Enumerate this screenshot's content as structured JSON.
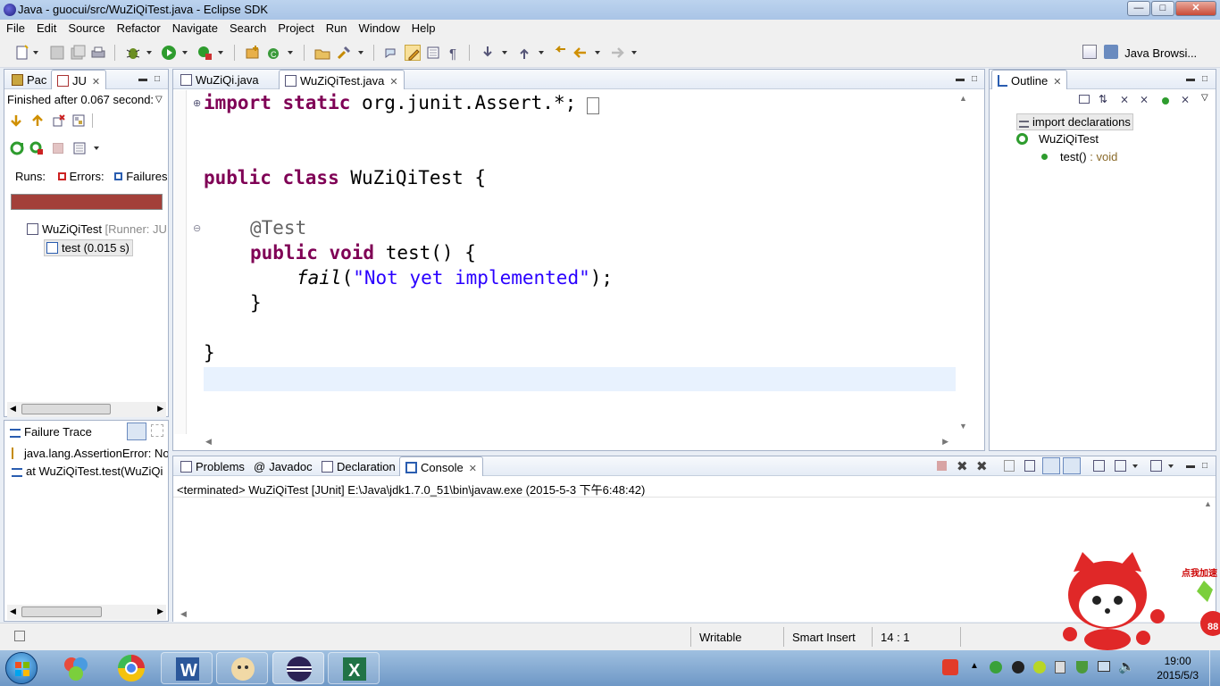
{
  "window": {
    "title": "Java - guocui/src/WuZiQiTest.java - Eclipse SDK"
  },
  "menu": [
    "File",
    "Edit",
    "Source",
    "Refactor",
    "Navigate",
    "Search",
    "Project",
    "Run",
    "Window",
    "Help"
  ],
  "toolbar": {
    "perspective_label": "Java Browsi..."
  },
  "left_panel": {
    "tabs": [
      {
        "label": "Pac"
      },
      {
        "label": "JU"
      }
    ],
    "status": "Finished after 0.067 second:",
    "runs_label": "Runs:",
    "errors_label": "Errors:",
    "failures_label": "Failures",
    "progress_state": "failed",
    "progress_color": "#a3403a",
    "tree": [
      {
        "label": "WuZiQiTest",
        "suffix": " [Runner: JU"
      },
      {
        "label": "test (0.015 s)"
      }
    ]
  },
  "failure_trace": {
    "title": "Failure Trace",
    "lines": [
      "java.lang.AssertionError: No",
      "at WuZiQiTest.test(WuZiQi"
    ]
  },
  "editor": {
    "tabs": [
      {
        "label": "WuZiQi.java"
      },
      {
        "label": "WuZiQiTest.java"
      }
    ],
    "code": {
      "l1": {
        "kw": "import static",
        "rest": " org.junit.Assert.*;"
      },
      "l2": {
        "kw": "public class",
        "rest": " WuZiQiTest {"
      },
      "l3": {
        "ann": "@Test"
      },
      "l4": {
        "kw": "public void",
        "rest": " test() {"
      },
      "l5": {
        "call": "fail",
        "open": "(",
        "str": "\"Not yet implemented\"",
        "close": ");"
      },
      "l6": {
        "text": "}"
      },
      "l7": {
        "text": "}"
      }
    }
  },
  "outline": {
    "tab": "Outline",
    "items": [
      {
        "label": "import declarations"
      },
      {
        "label": "WuZiQiTest"
      },
      {
        "label": "test()",
        "type": " : void"
      }
    ]
  },
  "bottom": {
    "tabs": [
      {
        "label": "Problems"
      },
      {
        "label": "Javadoc"
      },
      {
        "label": "Declaration"
      },
      {
        "label": "Console"
      }
    ],
    "console_header": "<terminated> WuZiQiTest [JUnit] E:\\Java\\jdk1.7.0_51\\bin\\javaw.exe (2015-5-3 下午6:48:42)"
  },
  "statusbar": {
    "writable": "Writable",
    "insert_mode": "Smart Insert",
    "position": "14 : 1"
  },
  "overlay": {
    "label": "点我加速",
    "badge": "88"
  },
  "taskbar": {
    "time": "19:00",
    "date": "2015/5/3"
  }
}
